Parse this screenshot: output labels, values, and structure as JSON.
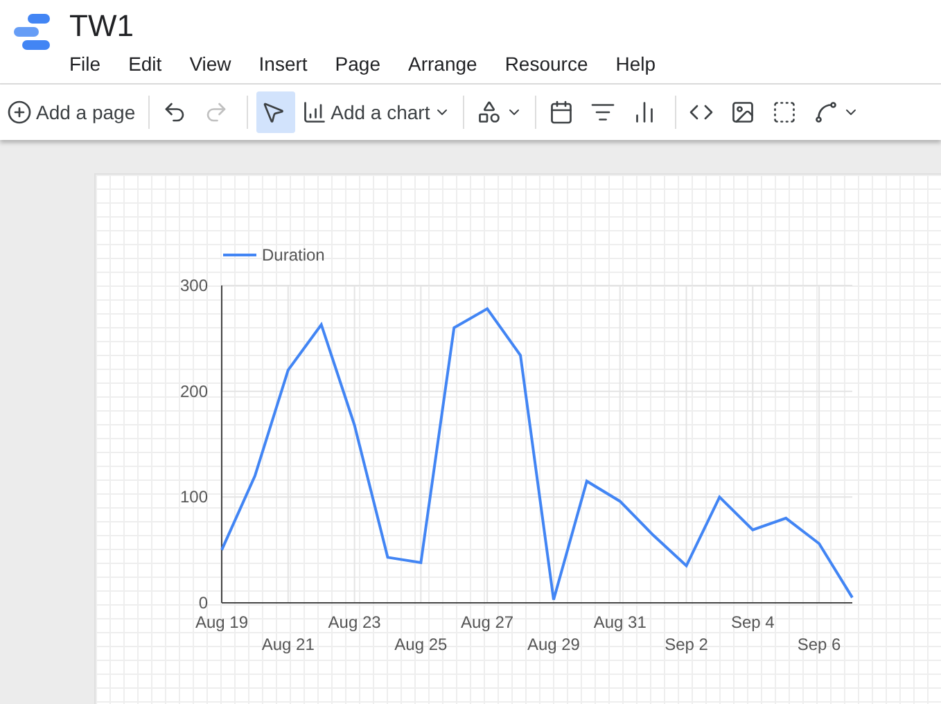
{
  "app": {
    "title": "TW1"
  },
  "menu": [
    "File",
    "Edit",
    "View",
    "Insert",
    "Page",
    "Arrange",
    "Resource",
    "Help"
  ],
  "toolbar": [
    {
      "kind": "add-page",
      "label": "Add a page"
    },
    {
      "kind": "separator"
    },
    {
      "kind": "undo",
      "disabled": false
    },
    {
      "kind": "redo",
      "disabled": true
    },
    {
      "kind": "separator"
    },
    {
      "kind": "select",
      "selected": true
    },
    {
      "kind": "add-chart",
      "label": "Add a chart"
    },
    {
      "kind": "separator"
    },
    {
      "kind": "components"
    },
    {
      "kind": "separator"
    },
    {
      "kind": "calendar",
      "selected": false
    },
    {
      "kind": "filter",
      "selected": false
    },
    {
      "kind": "data-control",
      "selected": false
    },
    {
      "kind": "separator"
    },
    {
      "kind": "code"
    },
    {
      "kind": "image"
    },
    {
      "kind": "text-box"
    },
    {
      "kind": "line"
    }
  ],
  "chart": {
    "chart_data": {
      "type": "line",
      "categories": [
        "Aug 19",
        null,
        "Aug 21",
        null,
        "Aug 23",
        null,
        "Aug 25",
        null,
        "Aug 27",
        null,
        "Aug 29",
        null,
        "Aug 31",
        null,
        "Sep 2",
        null,
        "Sep 4",
        null,
        "Sep 6",
        null
      ],
      "series": [
        {
          "name": "Duration",
          "color": "#4285f4",
          "values": [
            50,
            120,
            220,
            263,
            168,
            43,
            38,
            260,
            278,
            234,
            3,
            115,
            96,
            64,
            35,
            100,
            69,
            80,
            56,
            5
          ]
        }
      ],
      "ylim": [
        0,
        300
      ],
      "yticks": [
        0,
        100,
        200,
        300
      ],
      "grid": true
    }
  }
}
